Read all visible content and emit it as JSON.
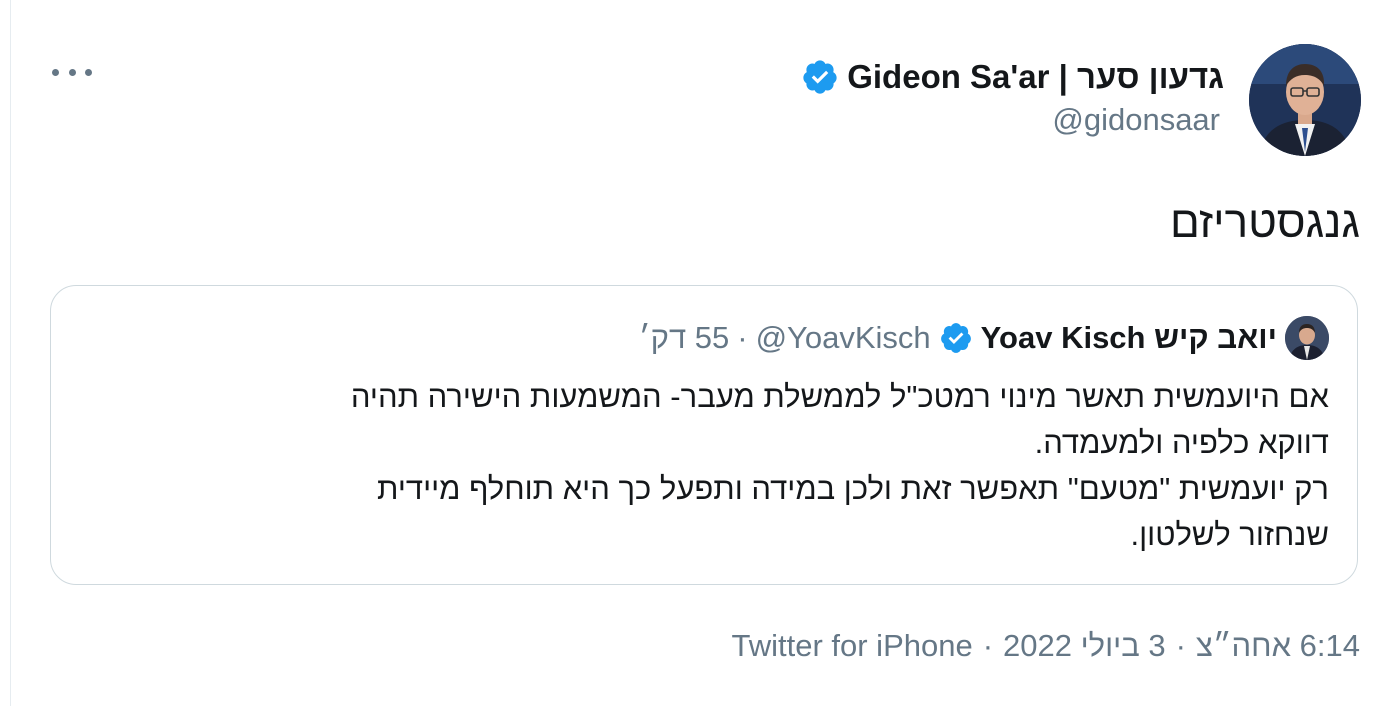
{
  "author": {
    "display_name": "גדעון סער | Gideon Sa'ar",
    "handle": "@gidonsaar",
    "verified_icon": "verified-badge-icon",
    "avatar_icon": "profile-photo"
  },
  "menu": {
    "icon": "more-options-icon"
  },
  "tweet": {
    "text": "גנגסטריזם"
  },
  "quoted_tweet": {
    "display_name": "יואב קיש Yoav Kisch",
    "handle": "@YoavKisch",
    "separator": "·",
    "time": "55 דק׳",
    "lines": [
      "אם היועמשית תאשר מינוי רמטכ\"ל לממשלת מעבר- המשמעות הישירה תהיה",
      "דווקא כלפיה ולמעמדה.",
      "רק יועמשית \"מטעם\" תאפשר זאת ולכן במידה ותפעל כך היא תוחלף מיידית",
      "שנחזור לשלטון."
    ]
  },
  "meta": {
    "time": "6:14 אחה״צ",
    "separator": "·",
    "date": "3 ביולי 2022",
    "source": "Twitter for iPhone"
  },
  "colors": {
    "verified": "#1d9bf0",
    "secondary_text": "#657786",
    "primary_text": "#14171a",
    "border": "#cfd9de"
  }
}
